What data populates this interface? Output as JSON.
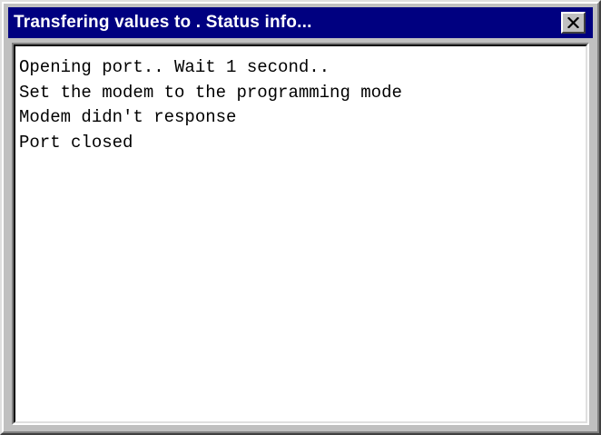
{
  "window": {
    "title": "Transfering values to . Status info..."
  },
  "controls": {
    "close_icon": "close-icon"
  },
  "log": {
    "lines": [
      "Opening port.. Wait 1 second..",
      "Set the modem to the programming mode",
      "Modem didn't response",
      "Port closed"
    ]
  },
  "colors": {
    "titlebar": "#000080",
    "title_text": "#ffffff",
    "window_face": "#c0c0c0",
    "log_background": "#ffffff",
    "log_text": "#000000"
  }
}
